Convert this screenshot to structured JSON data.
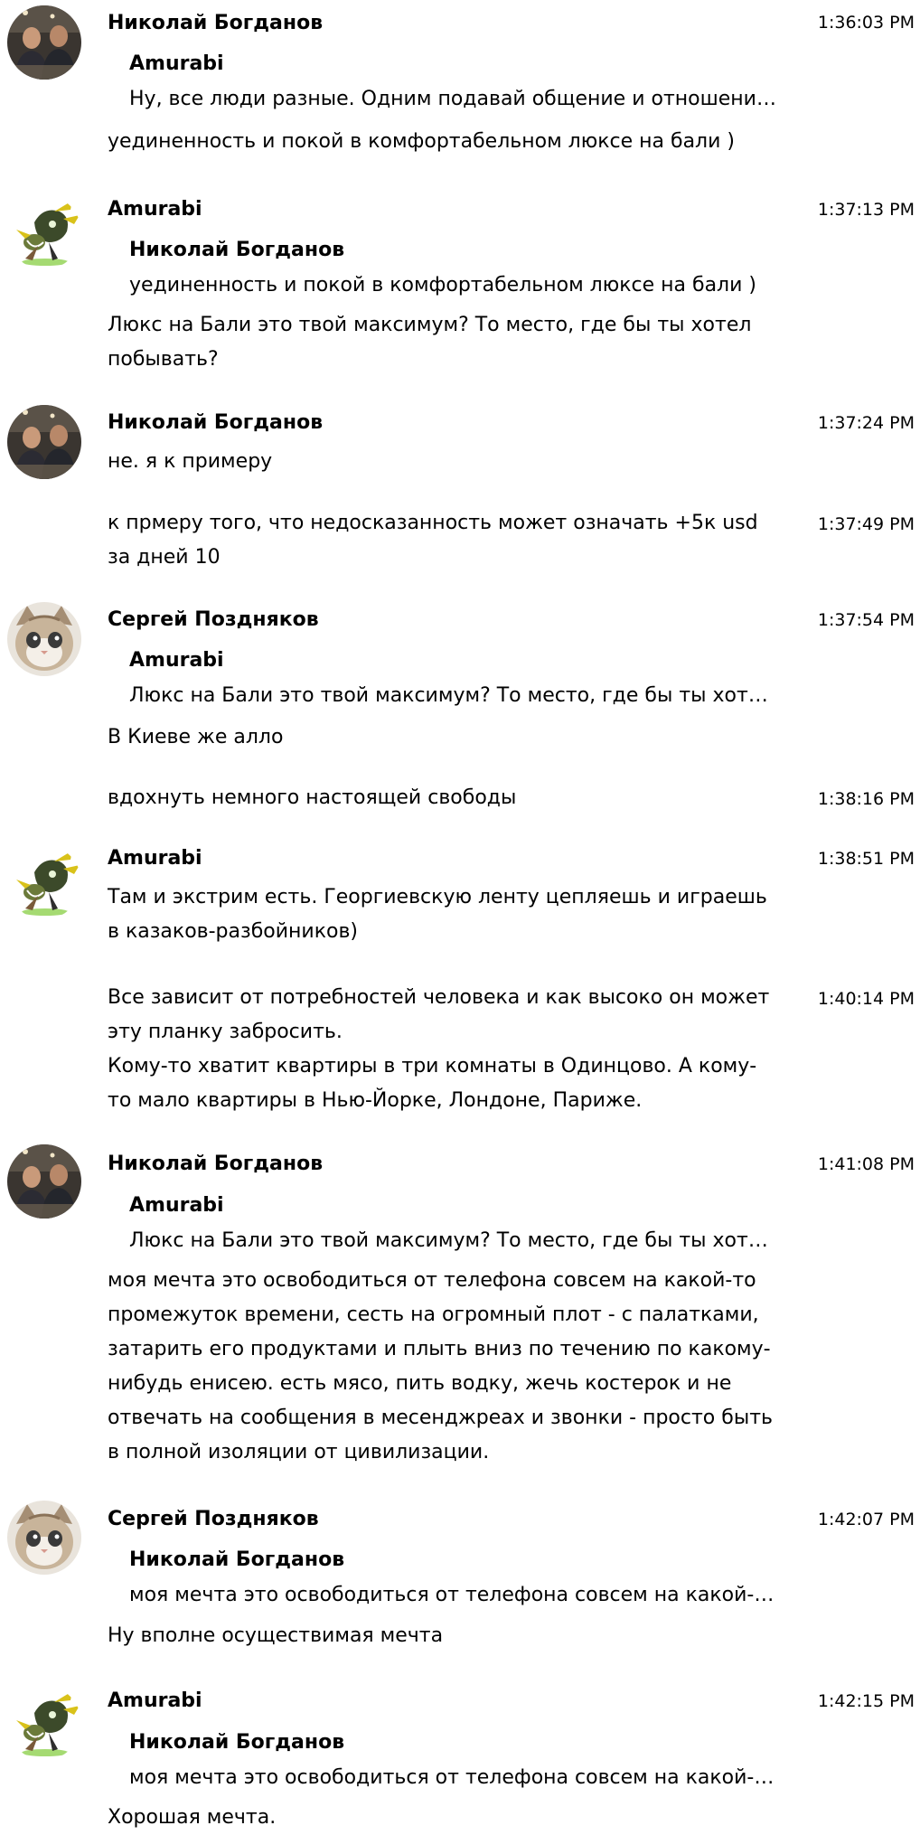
{
  "messages": [
    {
      "author": "Николай Богданов",
      "avatar": "nikolay-avatar-icon",
      "time": "1:36:03 PM",
      "quote_author": "Amurabi",
      "quote_text": "Ну, все люди разные. Одним подавай общение и отношени…",
      "text": "уединенность и покой в комфортабельном люксе на бали )"
    },
    {
      "author": "Amurabi",
      "avatar": "amurabi-avatar-icon",
      "time": "1:37:13 PM",
      "quote_author": "Николай Богданов",
      "quote_text": "уединенность и покой в комфортабельном люксе на бали )",
      "text": "Люкс на Бали это твой максимум? То место, где бы ты хотел\nпобывать?"
    },
    {
      "author": "Николай Богданов",
      "avatar": "nikolay-avatar-icon",
      "time": "1:37:24 PM",
      "text": "не. я к примеру"
    },
    {
      "time": "1:37:49 PM",
      "text": "к прмеру того, что недосказанность может означать +5к usd\nза дней 10"
    },
    {
      "author": "Сергей Поздняков",
      "avatar": "sergey-cat-avatar-icon",
      "time": "1:37:54 PM",
      "quote_author": "Amurabi",
      "quote_text": "Люкс на Бали это твой максимум? То место, где бы ты хот…",
      "text": "В Киеве же алло"
    },
    {
      "time": "1:38:16 PM",
      "text": "вдохнуть немного настоящей свободы"
    },
    {
      "author": "Amurabi",
      "avatar": "amurabi-avatar-icon",
      "time": "1:38:51 PM",
      "text": "Там и экстрим есть. Георгиевскую ленту цепляешь и играешь\nв казаков-разбойников)"
    },
    {
      "time": "1:40:14 PM",
      "text": "Все зависит от потребностей человека и как высоко он может\nэту планку забросить.\nКому-то хватит квартиры в три комнаты в Одинцово. А кому-\nто мало квартиры в Нью-Йорке, Лондоне, Париже."
    },
    {
      "author": "Николай Богданов",
      "avatar": "nikolay-avatar-icon",
      "time": "1:41:08 PM",
      "quote_author": "Amurabi",
      "quote_text": "Люкс на Бали это твой максимум? То место, где бы ты хот…",
      "text": "моя мечта это освободиться от телефона совсем на какой-то\nпромежуток времени, сесть на огромный плот - с палатками,\nзатарить его продуктами и плыть вниз по течению по какому-\nнибудь енисею. есть мясо, пить водку, жечь костерок и не\nотвечать на сообщения в месенджреах и звонки - просто быть\nв полной изоляции от цивилизации."
    },
    {
      "author": "Сергей Поздняков",
      "avatar": "sergey-cat-avatar-icon",
      "time": "1:42:07 PM",
      "quote_author": "Николай Богданов",
      "quote_text": "моя мечта это освободиться от телефона совсем на какой-…",
      "text": "Ну вполне осуществимая мечта"
    },
    {
      "author": "Amurabi",
      "avatar": "amurabi-avatar-icon",
      "time": "1:42:15 PM",
      "quote_author": "Николай Богданов",
      "quote_text": "моя мечта это освободиться от телефона совсем на какой-…",
      "text": "Хорошая мечта."
    }
  ]
}
